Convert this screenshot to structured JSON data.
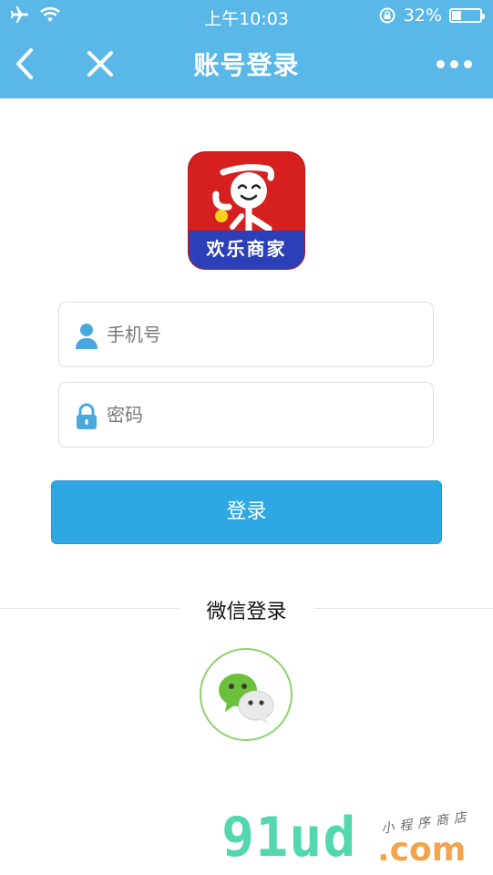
{
  "status_bar": {
    "time": "上午10:03",
    "battery_percent": "32%",
    "battery_level": 0.32
  },
  "nav": {
    "title": "账号登录",
    "icons": [
      "back-chevron-icon",
      "close-icon",
      "more-dots-icon"
    ]
  },
  "logo": {
    "brand_text": "欢乐商家"
  },
  "form": {
    "phone_placeholder": "手机号",
    "password_placeholder": "密码",
    "phone_value": "",
    "password_value": ""
  },
  "login_button": {
    "label": "登录"
  },
  "alt_login": {
    "label": "微信登录",
    "icon": "wechat-icon"
  },
  "watermark": {
    "main": "91ud",
    "suffix": ".com",
    "sub": "小程序商店"
  },
  "colors": {
    "header": "#5ab8e8",
    "button": "#2ea8e3",
    "wechat_ring": "#8fd16f",
    "logo_red": "#d61f1f",
    "logo_blue": "#2a3fb8"
  }
}
